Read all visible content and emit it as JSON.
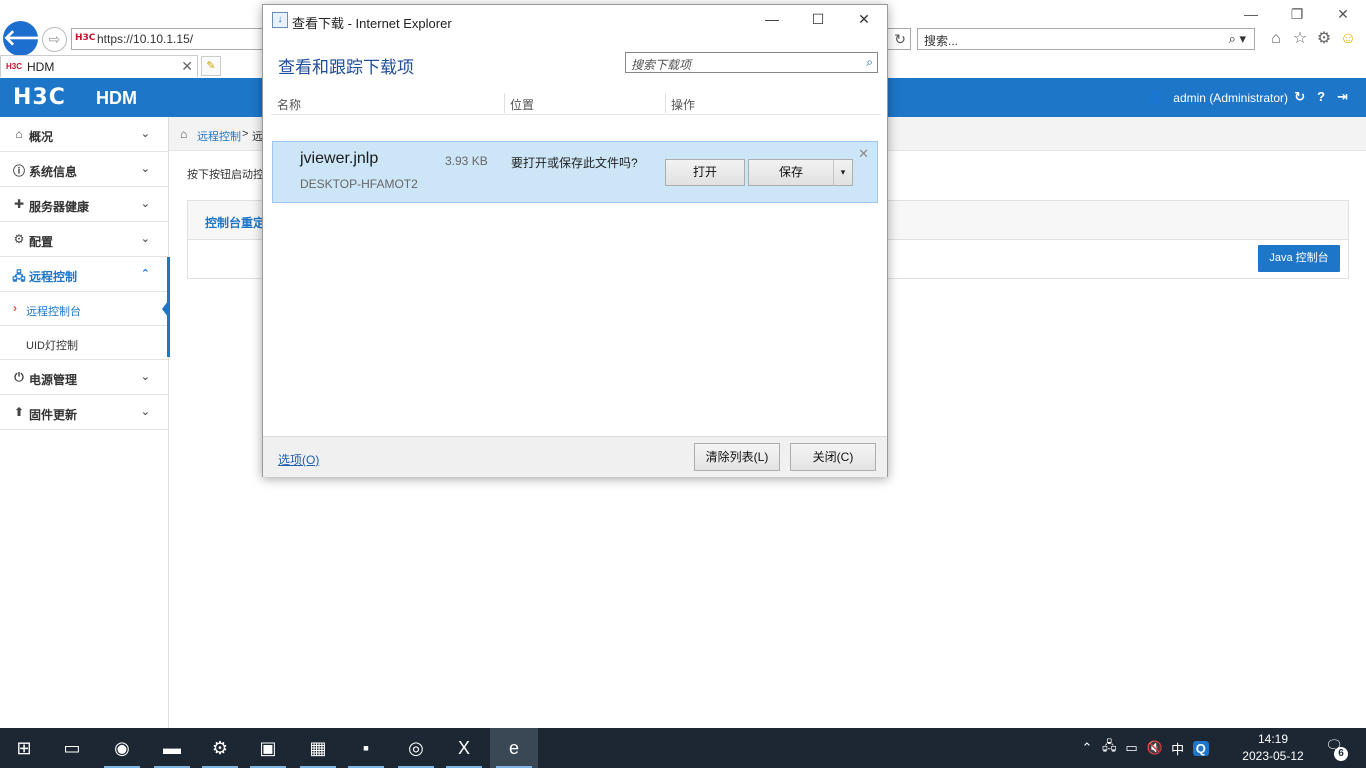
{
  "browser": {
    "back_glyph": "🡐",
    "forward_glyph": "⇨",
    "favicon_text": "H3C",
    "url": "https://10.10.1.15/",
    "refresh_glyph": "↻",
    "search_text": "搜索...",
    "search_icon": "search-icon",
    "search_glyph": "⌕ ▾",
    "toolbar": [
      {
        "name": "home-icon",
        "glyph": "⌂"
      },
      {
        "name": "favorites-star-icon",
        "glyph": "☆"
      },
      {
        "name": "gear-icon",
        "glyph": "⚙"
      },
      {
        "name": "smiley-feedback-icon",
        "glyph": "☺"
      }
    ],
    "caption": {
      "minimize": "—",
      "restore": "❐",
      "close": "✕"
    },
    "tab": {
      "title": "HDM",
      "close": "✕",
      "new_tab_glyph": "✎"
    }
  },
  "hdm": {
    "logo": "H3C",
    "product": "HDM",
    "user_icon": "user-icon",
    "user_glyph": "👤",
    "user": "admin (Administrator)",
    "header_icons": [
      {
        "name": "refresh-icon",
        "glyph": "↻"
      },
      {
        "name": "help-icon",
        "glyph": "?"
      },
      {
        "name": "logout-icon",
        "glyph": "⇥"
      }
    ],
    "menu": [
      {
        "label": "概况",
        "icon": "home-icon",
        "glyph": "⌂",
        "chevron": "⌄"
      },
      {
        "label": "系统信息",
        "icon": "info-icon",
        "glyph": "ⓘ",
        "chevron": "⌄"
      },
      {
        "label": "服务器健康",
        "icon": "health-plus-icon",
        "glyph": "✚",
        "chevron": "⌄"
      },
      {
        "label": "配置",
        "icon": "gear-icon",
        "glyph": "⚙",
        "chevron": "⌄"
      },
      {
        "label": "远程控制",
        "icon": "network-icon",
        "glyph": "🖧",
        "chevron": "⌃",
        "active": true
      },
      {
        "label": "电源管理",
        "icon": "power-icon",
        "glyph": "⏻",
        "chevron": "⌄"
      },
      {
        "label": "固件更新",
        "icon": "firmware-icon",
        "glyph": "⬆",
        "chevron": "⌄"
      }
    ],
    "submenu": [
      {
        "label": "远程控制台",
        "active": true,
        "marker": "›"
      },
      {
        "label": "UID灯控制",
        "active": false,
        "marker": ""
      }
    ],
    "breadcrumb": {
      "home_glyph": "⌂",
      "link": "远程控制",
      "sep": ">",
      "current": "远"
    },
    "description": "按下按钮启动控制",
    "panel_title": "控制台重定",
    "java_button": "Java 控制台",
    "accent_color": "#1e76c9"
  },
  "dialog": {
    "title_icon_glyph": "↓",
    "title": "查看下载 - Internet Explorer",
    "caption": {
      "minimize": "—",
      "maximize": "☐",
      "close": "✕"
    },
    "heading": "查看和跟踪下载项",
    "search_placeholder": "搜索下载项",
    "search_glyph": "⌕",
    "columns": [
      "名称",
      "位置",
      "操作"
    ],
    "download": {
      "filename": "jviewer.jnlp",
      "size": "3.93 KB",
      "source": "DESKTOP-HFAMOT2",
      "question": "要打开或保存此文件吗?",
      "open_label": "打开",
      "save_label": "保存",
      "save_menu_glyph": "▾",
      "dismiss_glyph": "✕"
    },
    "footer": {
      "options": "选项(O)",
      "clear_list": "清除列表(L)",
      "close": "关闭(C)"
    }
  },
  "taskbar": {
    "icons": [
      {
        "name": "windows-start-icon",
        "glyph": "⊞"
      },
      {
        "name": "task-view-icon",
        "glyph": "▭"
      },
      {
        "name": "edge-browser-icon",
        "glyph": "◉"
      },
      {
        "name": "file-explorer-icon",
        "glyph": "▬"
      },
      {
        "name": "settings-gear-icon",
        "glyph": "⚙"
      },
      {
        "name": "control-panel-icon",
        "glyph": "▣"
      },
      {
        "name": "server-manager-icon",
        "glyph": "▦"
      },
      {
        "name": "command-prompt-icon",
        "glyph": "▪"
      },
      {
        "name": "chrome-browser-icon",
        "glyph": "◎"
      },
      {
        "name": "excel-icon",
        "glyph": "X"
      },
      {
        "name": "internet-explorer-icon",
        "glyph": "e"
      }
    ],
    "tray": [
      {
        "name": "tray-expand-icon",
        "glyph": "⌃"
      },
      {
        "name": "network-tray-icon",
        "glyph": "🖧"
      },
      {
        "name": "battery-tray-icon",
        "glyph": "▭"
      },
      {
        "name": "volume-muted-icon",
        "glyph": "🔇"
      },
      {
        "name": "input-method-label",
        "glyph": "中"
      },
      {
        "name": "qq-tray-icon",
        "glyph": "Q"
      }
    ],
    "time": "14:19",
    "date": "2023-05-12",
    "notification_glyph": "🗨",
    "notification_count": "6"
  }
}
